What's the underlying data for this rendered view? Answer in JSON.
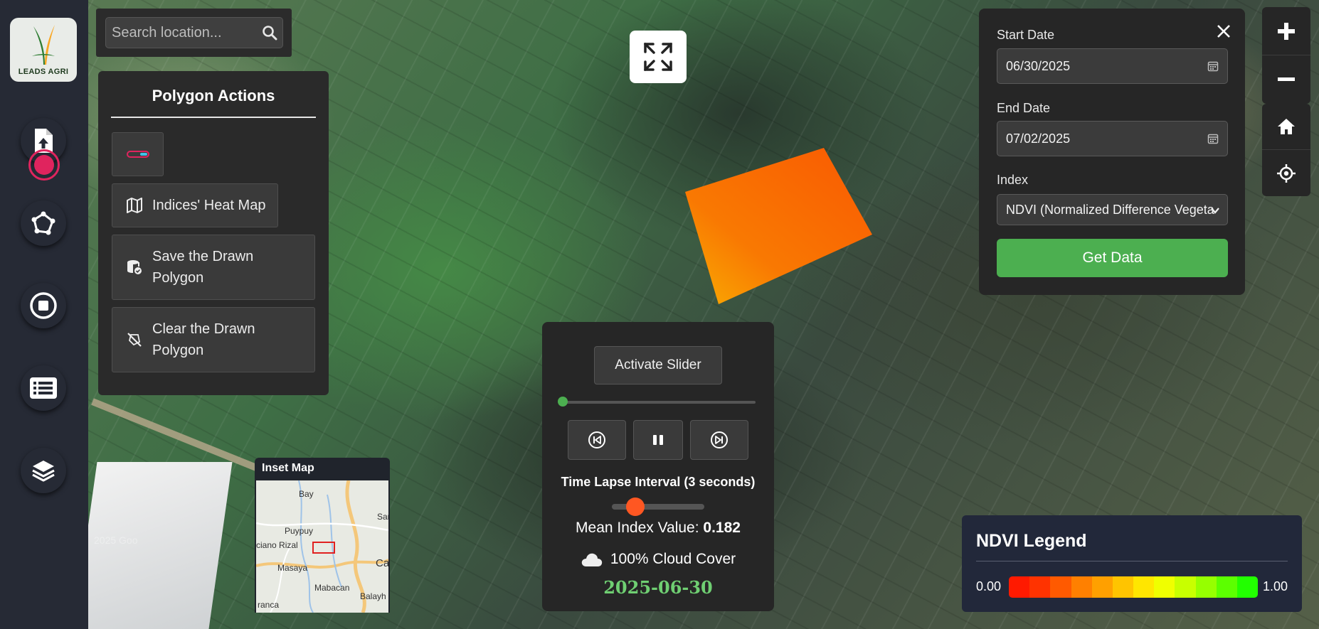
{
  "app": {
    "logo_text": "LEADS AGRI"
  },
  "search": {
    "placeholder": "Search location..."
  },
  "polygon_actions": {
    "title": "Polygon Actions",
    "heat_map_label": "Indices' Heat Map",
    "save_label_line1": "Save the Drawn",
    "save_label_line2": "Polygon",
    "clear_label_line1": "Clear the Drawn",
    "clear_label_line2": "Polygon"
  },
  "date_panel": {
    "start_label": "Start Date",
    "start_value": "06/30/2025",
    "end_label": "End Date",
    "end_value": "07/02/2025",
    "index_label": "Index",
    "index_value": "NDVI (Normalized Difference Vegeta",
    "get_data_label": "Get Data"
  },
  "time_lapse": {
    "activate_label": "Activate Slider",
    "slider_progress": 0,
    "interval_label": "Time Lapse Interval (3 seconds)",
    "interval_seconds": 3,
    "mean_prefix": "Mean Index Value: ",
    "mean_value": "0.182",
    "cloud_text": "100% Cloud Cover",
    "date": "2025-06-30"
  },
  "inset_map": {
    "title": "Inset Map",
    "places": [
      "Bay",
      "Puypuy",
      "ciano Rizal",
      "Masaya",
      "Mabacan",
      "Balayh",
      "Ca",
      "Sar",
      "ranca"
    ]
  },
  "map": {
    "watermark": "2025 Goo"
  },
  "legend": {
    "title": "NDVI Legend",
    "min": "0.00",
    "max": "1.00",
    "colors": [
      "#ff1a00",
      "#ff3300",
      "#ff5a00",
      "#ff8000",
      "#ffa000",
      "#ffc400",
      "#ffe600",
      "#f0ff00",
      "#c8ff00",
      "#96ff00",
      "#5cff00",
      "#22ff00"
    ]
  },
  "colors": {
    "accent_green": "#4caf50",
    "record_red": "#e0245e",
    "polygon_orange": "#ff6a00"
  }
}
